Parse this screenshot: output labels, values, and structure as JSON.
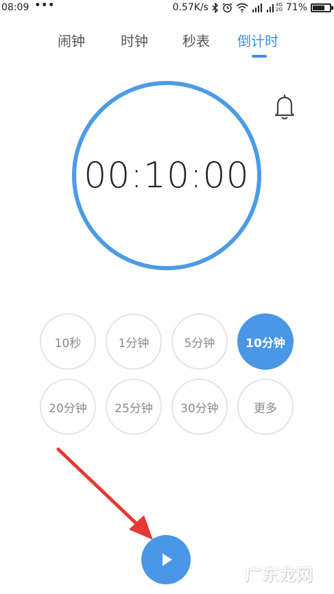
{
  "status_bar": {
    "time": "08:09",
    "dots": "•••",
    "speed": "0.57K/s",
    "net_top": "4G",
    "net_bottom": "2G",
    "battery": "71%",
    "battery_level": 0.71
  },
  "tabs": [
    {
      "label": "闹钟",
      "active": false
    },
    {
      "label": "时钟",
      "active": false
    },
    {
      "label": "秒表",
      "active": false
    },
    {
      "label": "倒计时",
      "active": true
    }
  ],
  "timer": {
    "display": "00:10:00"
  },
  "presets": [
    {
      "label": "10秒",
      "selected": false
    },
    {
      "label": "1分钟",
      "selected": false
    },
    {
      "label": "5分钟",
      "selected": false
    },
    {
      "label": "10分钟",
      "selected": true
    },
    {
      "label": "20分钟",
      "selected": false
    },
    {
      "label": "25分钟",
      "selected": false
    },
    {
      "label": "30分钟",
      "selected": false
    },
    {
      "label": "更多",
      "selected": false
    }
  ],
  "watermark": "广东龙网",
  "colors": {
    "accent": "#4a97e6",
    "tab_active": "#3c8fe0",
    "arrow": "#e53935"
  }
}
